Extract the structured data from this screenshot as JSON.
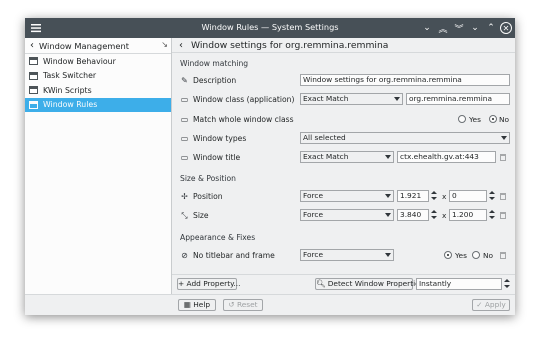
{
  "window": {
    "title": "Window Rules — System Settings",
    "title_buttons": [
      "chevron-down-icon",
      "keep-above-icon",
      "keep-below-icon",
      "minimize-icon",
      "maximize-icon",
      "close-icon"
    ]
  },
  "sidebar": {
    "header": "Window Management",
    "items": [
      {
        "label": "Window Behaviour",
        "active": false
      },
      {
        "label": "Task Switcher",
        "active": false
      },
      {
        "label": "KWin Scripts",
        "active": false
      },
      {
        "label": "Window Rules",
        "active": true
      }
    ]
  },
  "main": {
    "header": "Window settings for org.remmina.remmina",
    "sections": {
      "matching": "Window matching",
      "size_position": "Size & Position",
      "appearance": "Appearance & Fixes"
    },
    "rows": {
      "description": {
        "label": "Description",
        "value": "Window settings for org.remmina.remmina"
      },
      "window_class": {
        "label": "Window class (application)",
        "match": "Exact Match",
        "value": "org.remmina.remmina"
      },
      "whole_class": {
        "label": "Match whole window class",
        "yes": "Yes",
        "no": "No",
        "selected": "No"
      },
      "window_types": {
        "label": "Window types",
        "value": "All selected"
      },
      "window_title": {
        "label": "Window title",
        "match": "Exact Match",
        "value": "ctx.ehealth.gv.at:443"
      },
      "position": {
        "label": "Position",
        "policy": "Force",
        "x": "1.921",
        "y": "0",
        "sep": "x"
      },
      "size": {
        "label": "Size",
        "policy": "Force",
        "w": "3.840",
        "h": "1.200",
        "sep": "x"
      },
      "no_titlebar": {
        "label": "No titlebar and frame",
        "policy": "Force",
        "yes": "Yes",
        "no": "No",
        "selected": "Yes"
      }
    },
    "buttons": {
      "add_property": "Add Property...",
      "detect": "Detect Window Properties",
      "detect_delay": "Instantly",
      "help": "Help",
      "reset": "Reset",
      "apply": "Apply"
    }
  }
}
